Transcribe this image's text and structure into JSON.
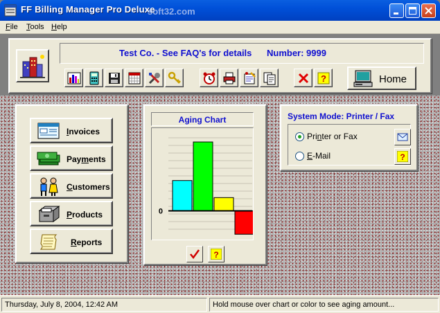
{
  "window": {
    "title": "FF Billing Manager Pro Deluxe",
    "watermark": "soft32.com",
    "app_icon": "app-window-icon",
    "controls": [
      "minimize-icon",
      "maximize-icon",
      "close-icon"
    ]
  },
  "menu": {
    "items": [
      {
        "key": "F",
        "rest": "ile"
      },
      {
        "key": "T",
        "rest": "ools"
      },
      {
        "key": "H",
        "rest": "elp"
      }
    ]
  },
  "toolbar": {
    "company": "Test Co. - See FAQ's for details",
    "number": "Number: 9999",
    "logo_icon": "office-building-icon",
    "buttons": [
      "bar-chart-icon",
      "calculator-icon",
      "floppy-disk-icon",
      "calendar-icon",
      "tools-icon",
      "key-icon",
      "alarm-clock-icon",
      "printer-icon",
      "notepad-icon",
      "documents-icon",
      "cancel-icon",
      "help-icon"
    ],
    "home_label": "Home"
  },
  "nav": {
    "buttons": [
      {
        "key": "I",
        "rest": "nvoices",
        "icon": "invoice-form-icon"
      },
      {
        "pre": "Pay",
        "key": "m",
        "rest": "ents",
        "icon": "money-stack-icon"
      },
      {
        "key": "C",
        "rest": "ustomers",
        "icon": "people-icon"
      },
      {
        "key": "P",
        "rest": "roducts",
        "icon": "file-drawer-icon"
      },
      {
        "key": "R",
        "rest": "eports",
        "icon": "scroll-icon"
      }
    ]
  },
  "aging_chart": {
    "title": "Aging Chart",
    "zero_label": "0",
    "buttons": [
      "checkmark-icon",
      "help-icon"
    ]
  },
  "chart_data": {
    "type": "bar",
    "title": "Aging Chart",
    "categories": [
      "",
      "",
      "",
      ""
    ],
    "values": [
      48,
      109,
      21,
      -37
    ],
    "colors": [
      "#00ffff",
      "#00ff00",
      "#ffff00",
      "#ff0000"
    ],
    "ylim": [
      -40,
      120
    ],
    "grid": true
  },
  "system_mode": {
    "title": "System Mode: Printer / Fax",
    "options": [
      {
        "pre": "Pri",
        "key": "n",
        "rest": "ter or Fax",
        "selected": true
      },
      {
        "pre": "",
        "key": "E",
        "rest": "-Mail",
        "selected": false
      }
    ],
    "buttons": [
      "envelope-icon",
      "help-icon"
    ]
  },
  "status": {
    "datetime": "Thursday, July 8, 2004, 12:42 AM",
    "hint": "Hold mouse over chart or color to see aging amount..."
  }
}
